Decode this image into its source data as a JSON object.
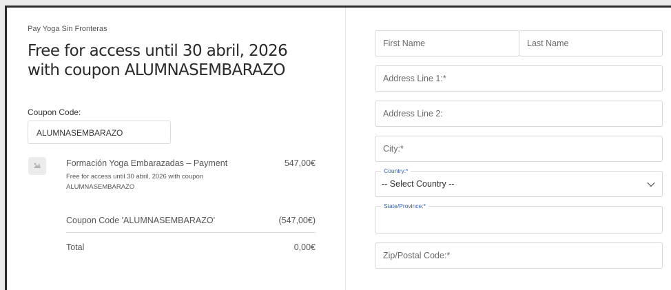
{
  "store_name": "Pay Yoga Sin Fronteras",
  "title": "Free for access until 30 abril, 2026 with coupon ALUMNASEMBARAZO",
  "coupon": {
    "label": "Coupon Code:",
    "value": "ALUMNASEMBARAZO"
  },
  "order": {
    "product_name": "Formación Yoga Embarazadas – Payment",
    "product_price": "547,00€",
    "product_description": "Free for access until 30 abril, 2026 with coupon ALUMNASEMBARAZO",
    "coupon_line_label": "Coupon Code 'ALUMNASEMBARAZO'",
    "coupon_line_value": "(547,00€)",
    "total_label": "Total",
    "total_value": "0,00€"
  },
  "form": {
    "first_name_placeholder": "First Name",
    "last_name_placeholder": "Last Name",
    "address1_placeholder": "Address Line 1:*",
    "address2_placeholder": "Address Line 2:",
    "city_placeholder": "City:*",
    "country_label": "Country:*",
    "country_value": "-- Select Country --",
    "state_label": "State/Province:*",
    "zip_placeholder": "Zip/Postal Code:*"
  },
  "icons": {
    "product": "product-placeholder-icon",
    "country_dropdown": "chevron-down-icon"
  }
}
